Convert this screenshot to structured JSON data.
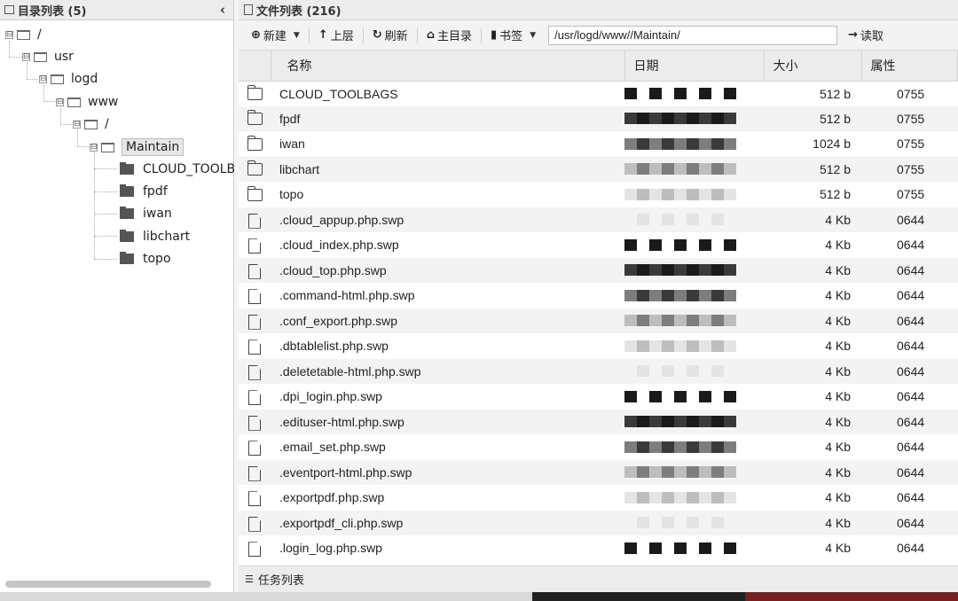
{
  "left": {
    "title": "目录列表 (5)",
    "collapse_icon": "chevron-left-icon",
    "tree": [
      {
        "label": "/",
        "expander": "⊟"
      },
      {
        "label": "usr",
        "expander": "⊟"
      },
      {
        "label": "logd",
        "expander": "⊟"
      },
      {
        "label": "www",
        "expander": "⊟"
      },
      {
        "label": "/",
        "expander": "⊟"
      },
      {
        "label": "Maintain",
        "expander": "⊟"
      },
      {
        "label": "CLOUD_TOOLBAGS"
      },
      {
        "label": "fpdf"
      },
      {
        "label": "iwan"
      },
      {
        "label": "libchart"
      },
      {
        "label": "topo"
      }
    ]
  },
  "right": {
    "title": "文件列表 (216)",
    "toolbar": {
      "new": "新建",
      "up": "上层",
      "refresh": "刷新",
      "home": "主目录",
      "bookmark": "书签",
      "path": "/usr/logd/www//Maintain/",
      "read": "读取"
    },
    "columns": {
      "name": "名称",
      "date": "日期",
      "size": "大小",
      "attr": "属性"
    },
    "rows": [
      {
        "type": "folder",
        "name": "CLOUD_TOOLBAGS",
        "size": "512 b",
        "attr": "0755"
      },
      {
        "type": "folder",
        "name": "fpdf",
        "size": "512 b",
        "attr": "0755"
      },
      {
        "type": "folder",
        "name": "iwan",
        "size": "1024 b",
        "attr": "0755"
      },
      {
        "type": "folder",
        "name": "libchart",
        "size": "512 b",
        "attr": "0755"
      },
      {
        "type": "folder",
        "name": "topo",
        "size": "512 b",
        "attr": "0755"
      },
      {
        "type": "file",
        "name": ".cloud_appup.php.swp",
        "size": "4 Kb",
        "attr": "0644"
      },
      {
        "type": "file",
        "name": ".cloud_index.php.swp",
        "size": "4 Kb",
        "attr": "0644"
      },
      {
        "type": "file",
        "name": ".cloud_top.php.swp",
        "size": "4 Kb",
        "attr": "0644"
      },
      {
        "type": "file",
        "name": ".command-html.php.swp",
        "size": "4 Kb",
        "attr": "0644"
      },
      {
        "type": "file",
        "name": ".conf_export.php.swp",
        "size": "4 Kb",
        "attr": "0644"
      },
      {
        "type": "file",
        "name": ".dbtablelist.php.swp",
        "size": "4 Kb",
        "attr": "0644"
      },
      {
        "type": "file",
        "name": ".deletetable-html.php.swp",
        "size": "4 Kb",
        "attr": "0644"
      },
      {
        "type": "file",
        "name": ".dpi_login.php.swp",
        "size": "4 Kb",
        "attr": "0644"
      },
      {
        "type": "file",
        "name": ".edituser-html.php.swp",
        "size": "4 Kb",
        "attr": "0644"
      },
      {
        "type": "file",
        "name": ".email_set.php.swp",
        "size": "4 Kb",
        "attr": "0644"
      },
      {
        "type": "file",
        "name": ".eventport-html.php.swp",
        "size": "4 Kb",
        "attr": "0644"
      },
      {
        "type": "file",
        "name": ".exportpdf.php.swp",
        "size": "4 Kb",
        "attr": "0644"
      },
      {
        "type": "file",
        "name": ".exportpdf_cli.php.swp",
        "size": "4 Kb",
        "attr": "0644"
      },
      {
        "type": "file",
        "name": ".login_log.php.swp",
        "size": "4 Kb",
        "attr": "0644"
      }
    ],
    "task_list": "任务列表"
  },
  "colors": {
    "panel_header": "#ececec",
    "row_stripe": "#f3f3f3",
    "selected_node": "#e7e7e7"
  }
}
